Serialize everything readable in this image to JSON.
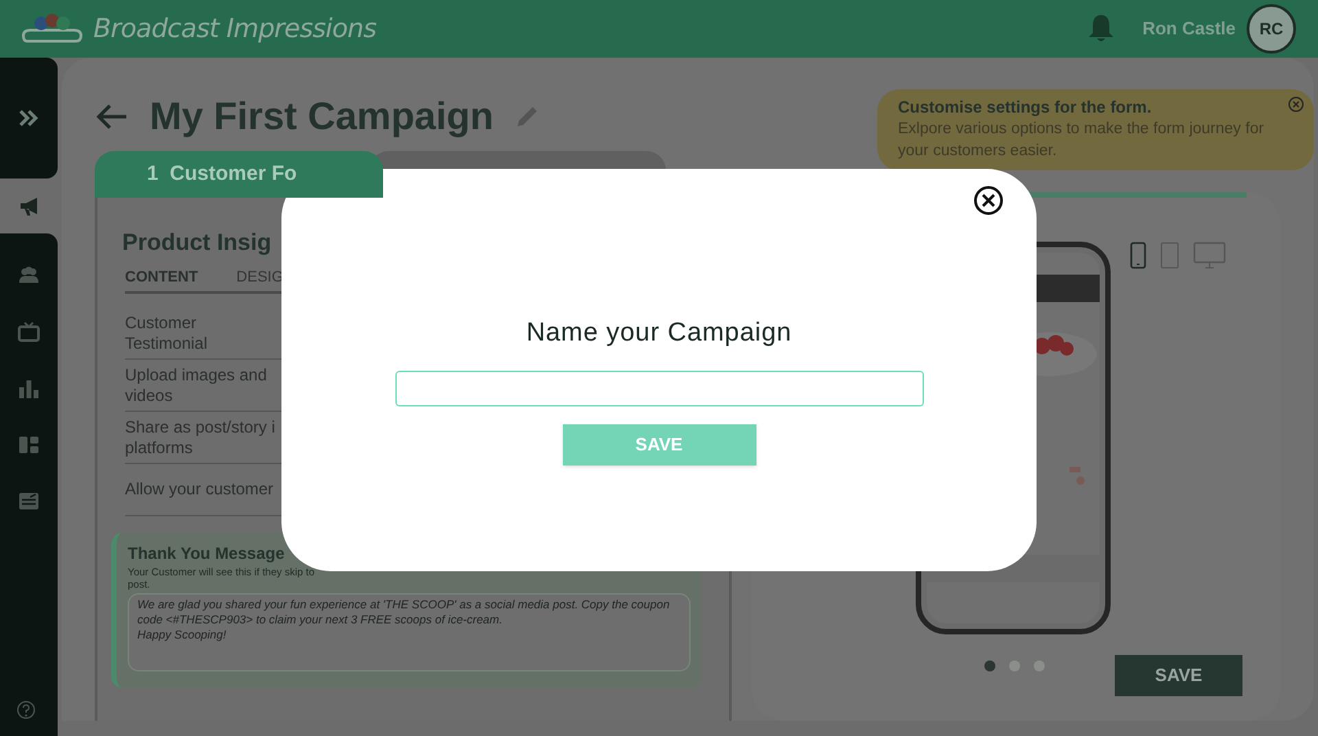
{
  "header": {
    "brand": "Broadcast Impressions",
    "user_name": "Ron Castle",
    "avatar_initials": "RC"
  },
  "sidebar": {
    "items": [
      {
        "kind": "megaphone",
        "selected": true
      },
      {
        "kind": "people",
        "selected": false
      },
      {
        "kind": "tv",
        "selected": false
      },
      {
        "kind": "chart",
        "selected": false
      },
      {
        "kind": "layout",
        "selected": false
      },
      {
        "kind": "news",
        "selected": false
      }
    ]
  },
  "page": {
    "title": "My First Campaign"
  },
  "tip": {
    "title": "Customise settings for the form.",
    "body": "Exlpore various options to make the form journey for your customers easier."
  },
  "steps": [
    {
      "label": "1  Customer Fo",
      "selected": true
    },
    {
      "selected": false
    }
  ],
  "panel": {
    "title": "Product Insig",
    "tabs": [
      {
        "label": "CONTENT",
        "selected": true
      },
      {
        "label": "DESIG",
        "selected": false
      }
    ],
    "rows": [
      {
        "lines": [
          "Customer",
          "Testimonial"
        ]
      },
      {
        "lines": [
          "Upload images and",
          "videos"
        ]
      },
      {
        "lines": [
          "Share as post/story i",
          "platforms"
        ]
      },
      {
        "lines": [
          "Allow your customer"
        ]
      }
    ]
  },
  "thank_you": {
    "title": "Thank You Message",
    "hint": "Your Customer will see this if they skip to post.",
    "message": "We are glad you shared your fun experience at 'THE SCOOP' as a social media post. Copy the coupon code <#THESCP903> to claim your next 3 FREE scoops of ice-cream.\nHappy Scooping!"
  },
  "preview": {
    "devices": [
      {
        "kind": "phone",
        "selected": true
      },
      {
        "kind": "tablet",
        "selected": false
      },
      {
        "kind": "desktop",
        "selected": false
      }
    ],
    "pages": [
      {
        "selected": true
      },
      {
        "selected": false
      },
      {
        "selected": false
      }
    ],
    "save_label": "SAVE"
  },
  "modal": {
    "title": "Name your Campaign",
    "save_label": "SAVE"
  }
}
